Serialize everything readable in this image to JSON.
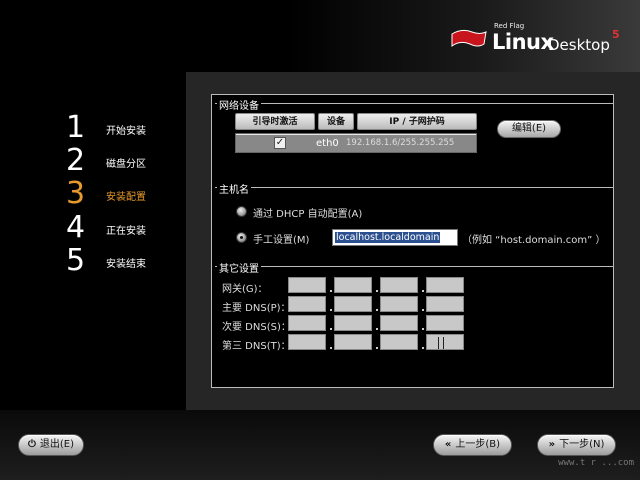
{
  "logo": {
    "small": "Red Flag",
    "brand": "Linux",
    "product": "Desktop",
    "version": "5"
  },
  "steps": [
    {
      "num": "1",
      "label": "开始安装",
      "active": false
    },
    {
      "num": "2",
      "label": "磁盘分区",
      "active": false
    },
    {
      "num": "3",
      "label": "安装配置",
      "active": true
    },
    {
      "num": "4",
      "label": "正在安装",
      "active": false
    },
    {
      "num": "5",
      "label": "安装结束",
      "active": false
    }
  ],
  "network": {
    "title": "网络设备",
    "columns": [
      "引导时激活",
      "设备",
      "IP / 子网护码"
    ],
    "rows": [
      {
        "active_on_boot": true,
        "device": "eth0",
        "ip": "192.168.1.6/255.255.255"
      }
    ],
    "edit_button": "编辑(E)"
  },
  "hostname": {
    "title": "主机名",
    "dhcp_label": "通过 DHCP 自动配置(A)",
    "manual_label": "手工设置(M)",
    "mode": "manual",
    "value": "localhost.localdomain",
    "example": "（例如 “host.domain.com” ）"
  },
  "misc": {
    "title": "其它设置",
    "fields": [
      {
        "label": "网关(G)：",
        "values": [
          "",
          "",
          "",
          ""
        ]
      },
      {
        "label": "主要 DNS(P)：",
        "values": [
          "",
          "",
          "",
          ""
        ]
      },
      {
        "label": "次要 DNS(S)：",
        "values": [
          "",
          "",
          "",
          ""
        ]
      },
      {
        "label": "第三 DNS(T)：",
        "values": [
          "",
          "",
          "",
          ""
        ]
      }
    ]
  },
  "footer": {
    "exit": "退出(E)",
    "back": "上一步(B)",
    "next": "下一步(N)",
    "watermark": "www.t r ...com"
  },
  "colors": {
    "accent": "#e89a2e",
    "panel_bg": "#262626"
  },
  "icons": {
    "exit": "power-icon",
    "back": "double-left-chevron-icon",
    "next": "double-right-chevron-icon"
  }
}
